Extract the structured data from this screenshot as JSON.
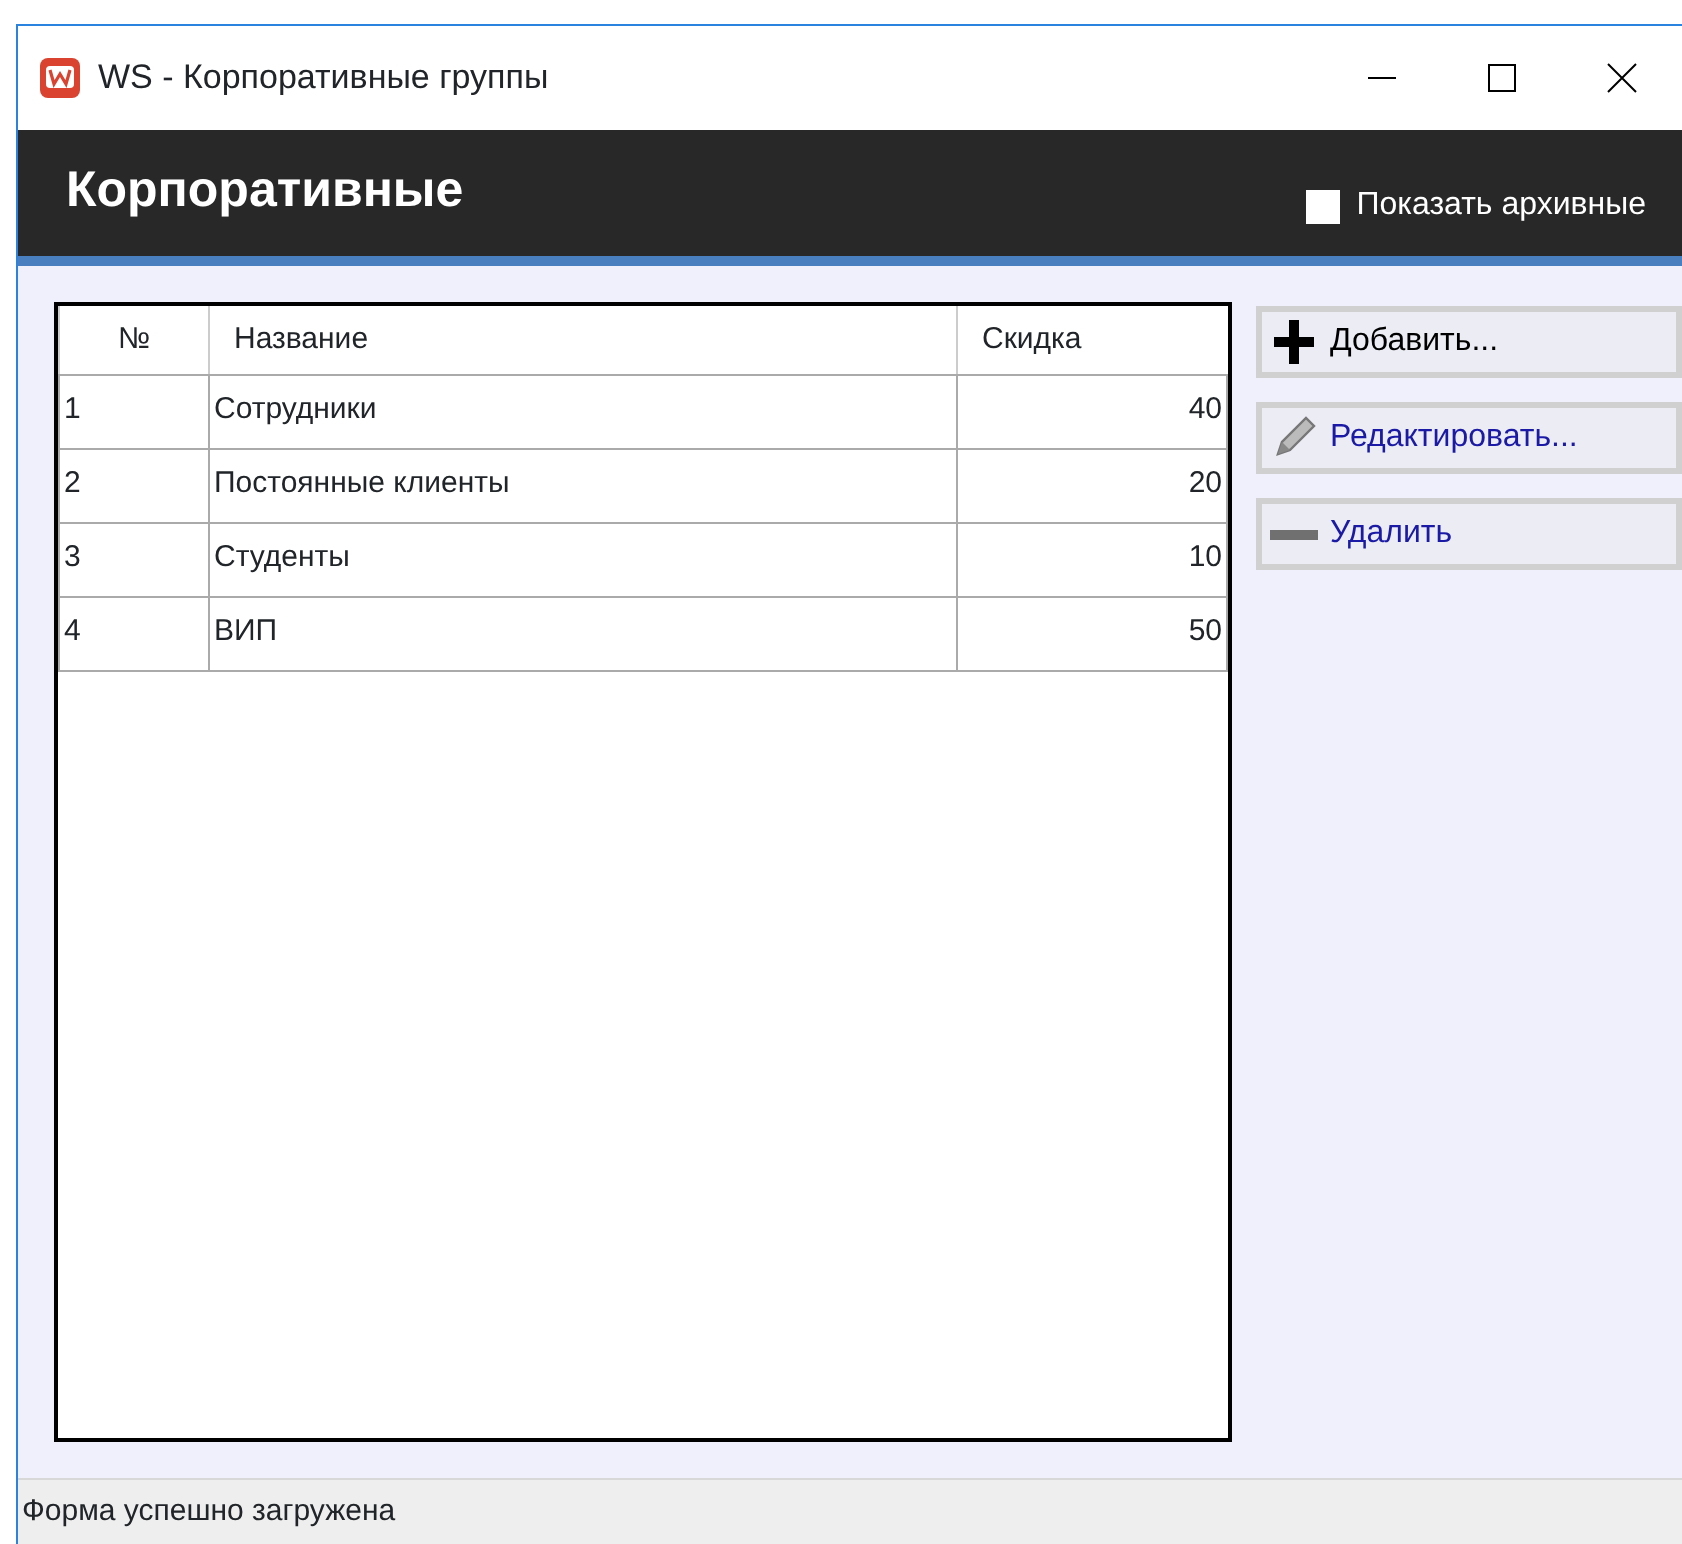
{
  "window": {
    "title": "WS - Корпоративные группы"
  },
  "header": {
    "title": "Корпоративные",
    "show_archived": {
      "label": "Показать архивные",
      "checked": false
    }
  },
  "table": {
    "columns": [
      "№",
      "Название",
      "Скидка"
    ],
    "rows": [
      [
        "1",
        "Сотрудники",
        "40"
      ],
      [
        "2",
        "Постоянные клиенты",
        "20"
      ],
      [
        "3",
        "Студенты",
        "10"
      ],
      [
        "4",
        "ВИП",
        "50"
      ]
    ]
  },
  "buttons": [
    {
      "kind": "add",
      "label": "Добавить...",
      "color": "#000000"
    },
    {
      "kind": "edit",
      "label": "Редактировать...",
      "color": "#1a1aa6"
    },
    {
      "kind": "delete",
      "label": "Удалить",
      "color": "#1a1aa6"
    }
  ],
  "status_bar": "Форма успешно загружена"
}
